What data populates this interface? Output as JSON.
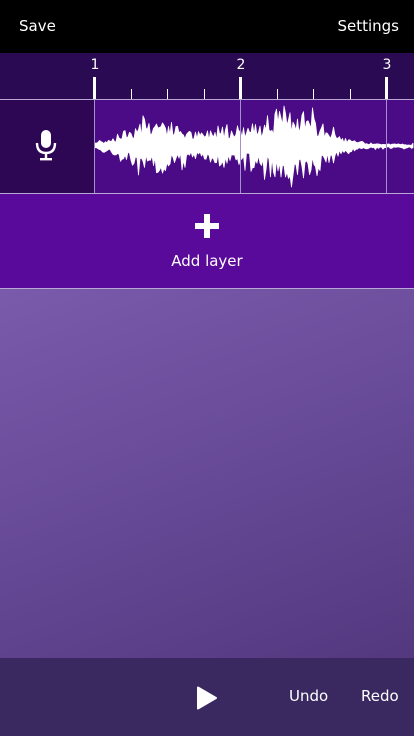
{
  "topbar": {
    "save_label": "Save",
    "settings_label": "Settings"
  },
  "ruler": {
    "bar_numbers": [
      "1",
      "2",
      "3"
    ]
  },
  "track": {
    "icon": "microphone-icon"
  },
  "add_layer": {
    "label": "Add layer",
    "icon": "plus-icon"
  },
  "transport": {
    "play_icon": "play-icon",
    "undo_label": "Undo",
    "redo_label": "Redo"
  },
  "colors": {
    "topbar_bg": "#000000",
    "ruler_bg": "#2a0a52",
    "track_bg": "#4b0a86",
    "mic_cell_bg": "#2d0753",
    "add_layer_bg": "#5a0a9a",
    "workspace_bg": "#6a4c9a",
    "bottombar_bg": "#3a2961",
    "waveform": "#ffffff"
  }
}
